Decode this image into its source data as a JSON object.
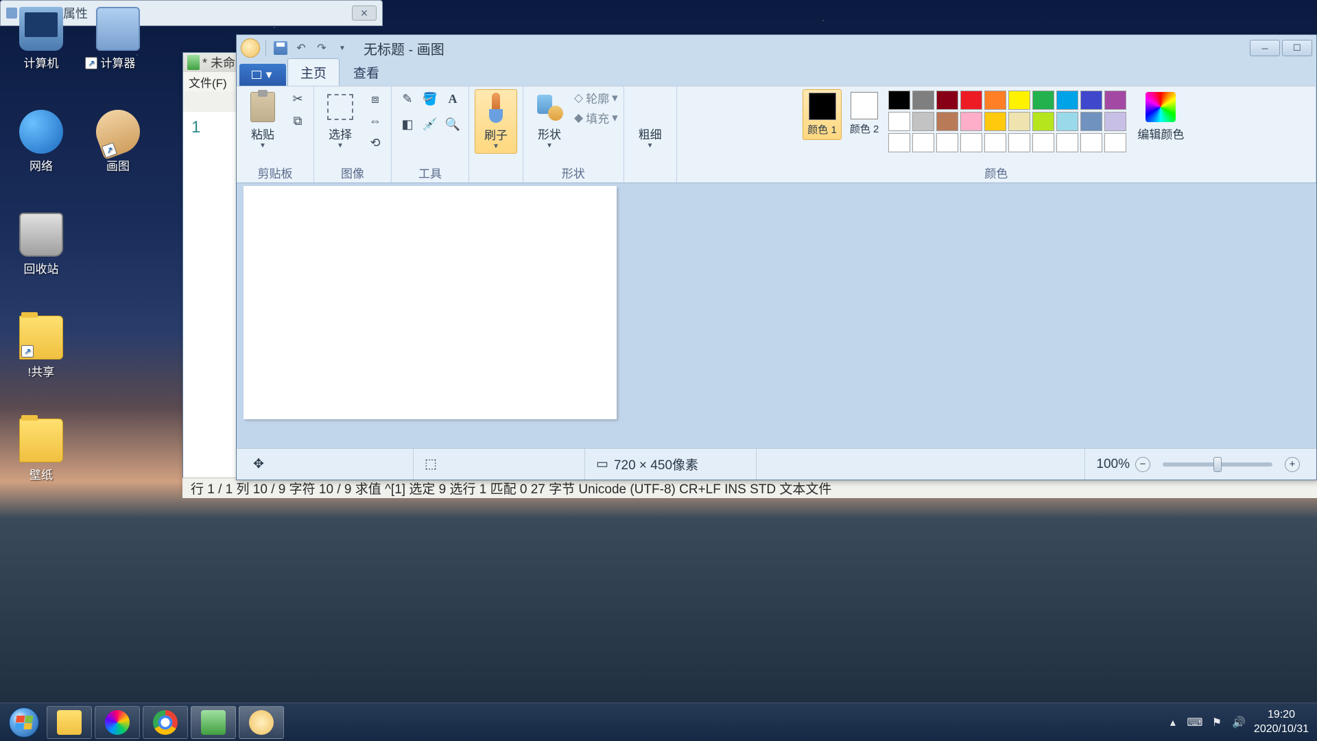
{
  "desktop": {
    "icons": [
      {
        "label": "计算机"
      },
      {
        "label": "计算器"
      },
      {
        "label": "网络"
      },
      {
        "label": "画图"
      },
      {
        "label": "回收站"
      },
      {
        "label": "!共享"
      },
      {
        "label": "壁纸"
      }
    ]
  },
  "calc_props": {
    "title": "计算器 属性"
  },
  "editor": {
    "title": "* 未命",
    "menu_file": "文件(F)",
    "line_no": "1",
    "status": "行 1 / 1    列 10 / 9 字符 10 / 9 求值 ^[1] 选定 9  选行 1  匹配 0  27 字节 Unicode (UTF-8) CR+LF INS STD 文本文件"
  },
  "paint": {
    "title": "无标题 - 画图",
    "tabs": {
      "home": "主页",
      "view": "查看"
    },
    "groups": {
      "clipboard": {
        "label": "剪贴板",
        "paste": "粘贴"
      },
      "image": {
        "label": "图像",
        "select": "选择"
      },
      "tools": {
        "label": "工具"
      },
      "brushes": {
        "label": "刷子"
      },
      "shapes": {
        "label": "形状",
        "shape": "形状",
        "outline": "轮廓",
        "fill": "填充"
      },
      "thickness": {
        "label": "粗细"
      },
      "colors": {
        "label": "颜色",
        "c1": "颜色 1",
        "c2": "颜色 2",
        "edit": "编辑颜色"
      }
    },
    "palette": [
      "#000000",
      "#7f7f7f",
      "#880015",
      "#ed1c24",
      "#ff7f27",
      "#fff200",
      "#22b14c",
      "#00a2e8",
      "#3f48cc",
      "#a349a4",
      "#ffffff",
      "#c3c3c3",
      "#b97a57",
      "#ffaec9",
      "#ffc90e",
      "#efe4b0",
      "#b5e61d",
      "#99d9ea",
      "#7092be",
      "#c8bfe7",
      "#ffffff",
      "#ffffff",
      "#ffffff",
      "#ffffff",
      "#ffffff",
      "#ffffff",
      "#ffffff",
      "#ffffff",
      "#ffffff",
      "#ffffff"
    ],
    "status": {
      "dims": "720 × 450像素",
      "zoom": "100%"
    }
  },
  "taskbar": {
    "time": "19:20",
    "date": "2020/10/31"
  }
}
